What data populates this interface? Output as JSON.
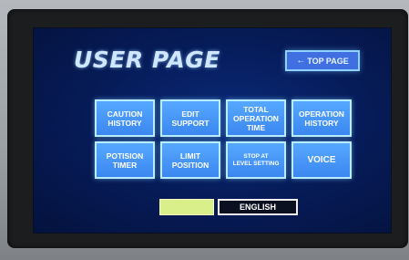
{
  "page": {
    "title": "USER PAGE",
    "top_page_label": "TOP PAGE"
  },
  "menu": [
    {
      "label": "CAUTION\nHISTORY",
      "icon": null
    },
    {
      "label": "EDIT\nSUPPORT",
      "icon": null
    },
    {
      "label": "TOTAL\nOPERATION\nTIME",
      "icon": null
    },
    {
      "label": "OPERATION\nHISTORY",
      "icon": null
    },
    {
      "label": "POTISION\nTIMER",
      "icon": null
    },
    {
      "label": "LIMIT\nPOSITION",
      "icon": null
    },
    {
      "label": "STOP AT\nLEVEL SETTING",
      "icon": null
    },
    {
      "label": "VOICE",
      "icon": null
    }
  ],
  "language": {
    "english_label": "ENGLISH"
  },
  "colors": {
    "screen_bg": "#061a55",
    "button_fill": "#3b87f0",
    "button_border": "#b8ecff",
    "language_selected_fill": "#d9f08a"
  }
}
